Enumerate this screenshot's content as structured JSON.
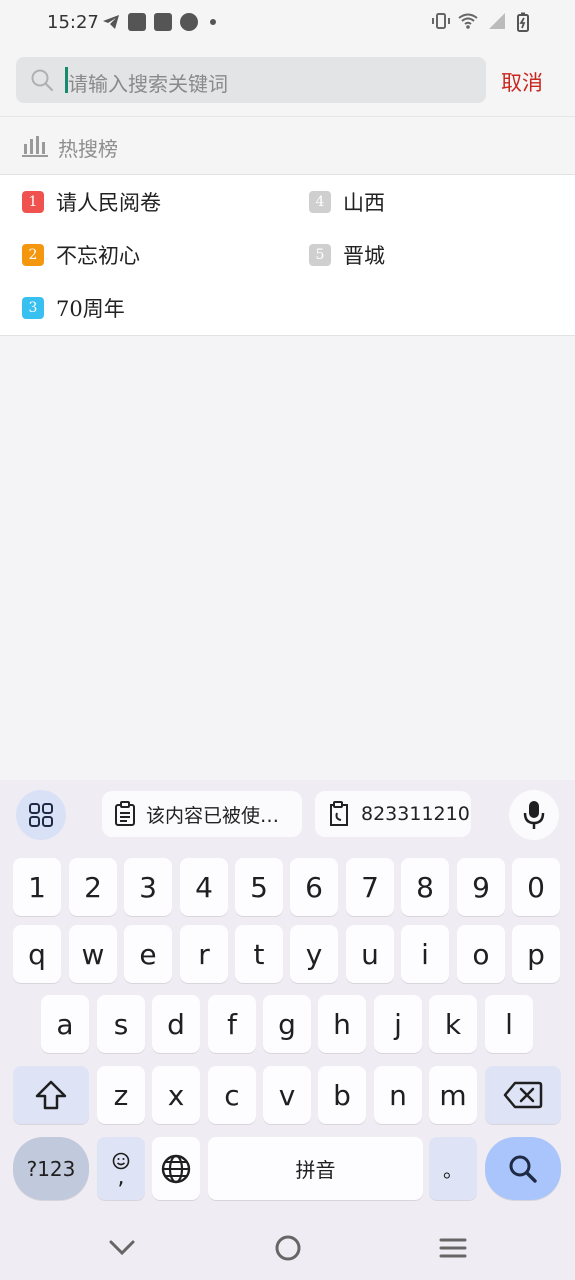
{
  "status": {
    "time": "15:27"
  },
  "search": {
    "placeholder": "请输入搜索关键词",
    "cancel_label": "取消"
  },
  "hot": {
    "title": "热搜榜",
    "items": [
      {
        "rank": "1",
        "label": "请人民阅卷",
        "color": "#f0524f"
      },
      {
        "rank": "2",
        "label": "不忘初心",
        "color": "#f5960f"
      },
      {
        "rank": "3",
        "label": "70周年",
        "color": "#38c0f0"
      },
      {
        "rank": "4",
        "label": "山西",
        "color": "#cfcfcf"
      },
      {
        "rank": "5",
        "label": "晋城",
        "color": "#cfcfcf"
      }
    ]
  },
  "keyboard": {
    "clipboard_chip_1": "该内容已被使…",
    "clipboard_chip_2": "823311210",
    "row_numbers": [
      "1",
      "2",
      "3",
      "4",
      "5",
      "6",
      "7",
      "8",
      "9",
      "0"
    ],
    "row_1": [
      "q",
      "w",
      "e",
      "r",
      "t",
      "y",
      "u",
      "i",
      "o",
      "p"
    ],
    "row_2": [
      "a",
      "s",
      "d",
      "f",
      "g",
      "h",
      "j",
      "k",
      "l"
    ],
    "row_3": [
      "z",
      "x",
      "c",
      "v",
      "b",
      "n",
      "m"
    ],
    "symbols_key": "?123",
    "comma_key": ",",
    "space_label": "拼音",
    "period_key": "。"
  },
  "icons": {
    "search": "search-icon",
    "chart": "bar-chart-icon",
    "grid": "apps-grid-icon",
    "clipboard": "clipboard-icon",
    "mic": "microphone-icon",
    "shift": "shift-icon",
    "backspace": "backspace-icon",
    "globe": "globe-icon",
    "emoji": "emoji-icon",
    "nav_back": "chevron-down-icon",
    "nav_home": "home-circle-icon",
    "nav_recent": "menu-lines-icon"
  }
}
